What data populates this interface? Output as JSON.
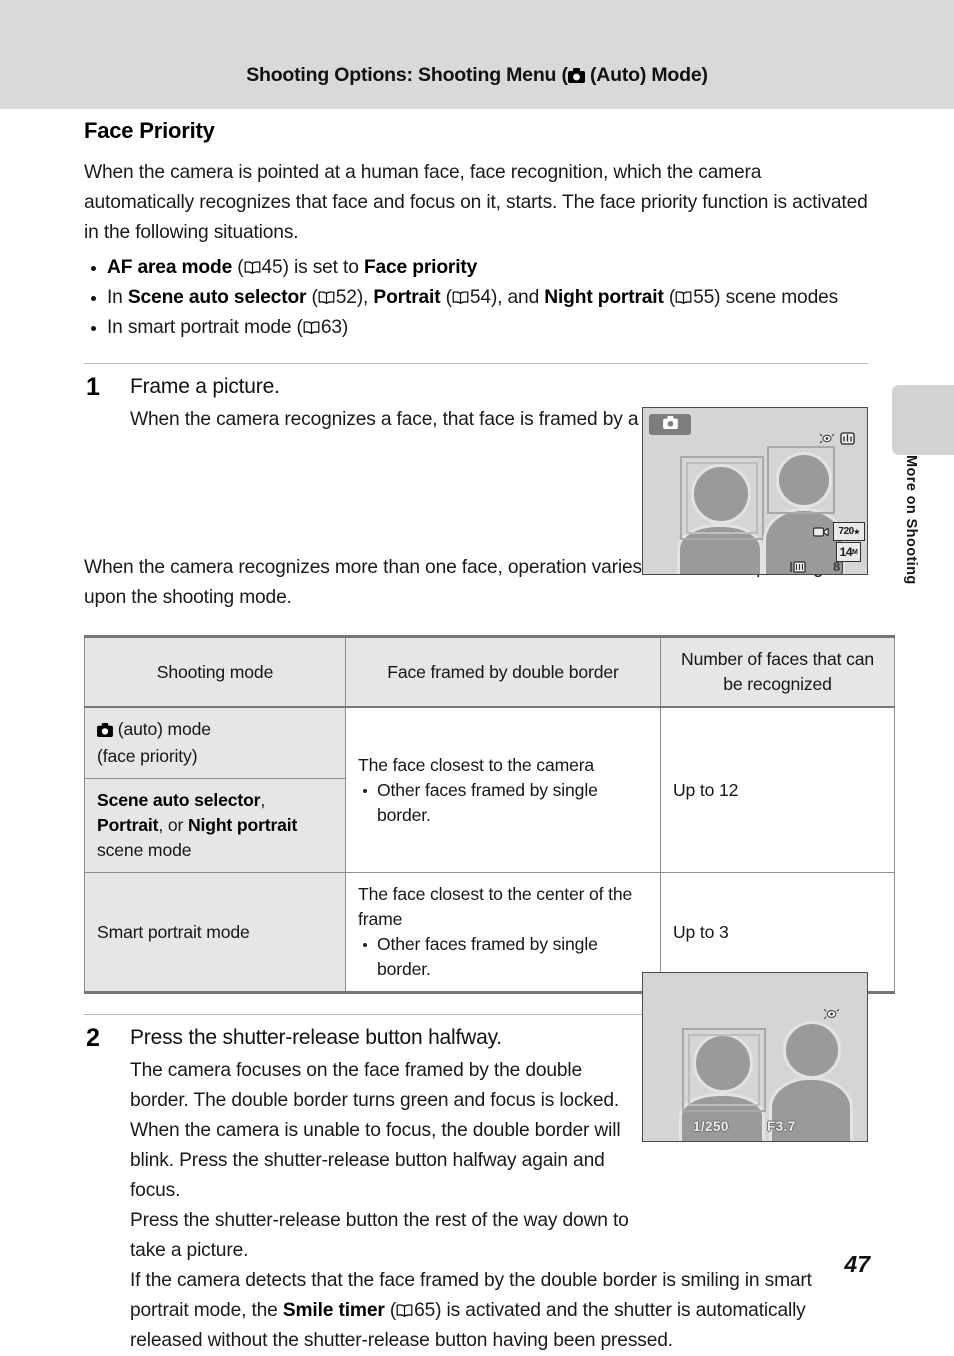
{
  "header": {
    "title_before": "Shooting Options: Shooting Menu (",
    "camera_icon": "camera-icon",
    "title_after": " (Auto) Mode)"
  },
  "thumb_tab": {
    "label": "More on Shooting"
  },
  "section": {
    "title": "Face Priority",
    "intro": "When the camera is pointed at a human face, face recognition, which the camera automatically recognizes that face and focus on it, starts. The face priority function is activated in the following situations."
  },
  "bullets": [
    {
      "pre": "",
      "bold1": "AF area mode",
      "mid1": " (",
      "ref1": "45",
      "mid2": ") is set to ",
      "bold2": "Face priority",
      "post": ""
    },
    {
      "pre": "In ",
      "bold1": "Scene auto selector",
      "mid1": " (",
      "ref1": "52",
      "mid2": "), ",
      "bold2": "Portrait",
      "mid3": " (",
      "ref2": "54",
      "mid4": "), and ",
      "bold3": "Night portrait",
      "mid5": " (",
      "ref3": "55",
      "post": ") scene modes"
    },
    {
      "pre": "In smart portrait mode (",
      "ref1": "63",
      "post": ")"
    }
  ],
  "steps": [
    {
      "number": "1",
      "heading": "Frame a picture.",
      "body": "When the camera recognizes a face, that face is framed by a yellow double border."
    },
    {
      "number": "2",
      "heading": "Press the shutter-release button halfway.",
      "para1": "The camera focuses on the face framed by the double border. The double border turns green and focus is locked. When the camera is unable to focus, the double border will blink. Press the shutter-release button halfway again and focus.",
      "para2": "Press the shutter-release button the rest of the way down to take a picture.",
      "para3_pre": "If the camera detects that the face framed by the double border is smiling in smart portrait mode, the ",
      "para3_bold": "Smile timer",
      "para3_mid": " (",
      "para3_ref": "65",
      "para3_post": ") is activated and the shutter is automatically released without the shutter-release button having been pressed."
    }
  ],
  "mid_paragraph": "When the camera recognizes more than one face, operation varies as follows depending upon the shooting mode.",
  "lcd1": {
    "mode_badge_icon": "camera-icon",
    "indicators": {
      "blink_icon": "blink-warning-icon",
      "vr_icon": "vibration-reduction-icon",
      "movie_icon": "movie-option-icon",
      "movie_option": "720",
      "image_size": "14",
      "image_size_unit": "M",
      "memory_icon": "internal-memory-icon",
      "shots_remaining": "8"
    }
  },
  "lcd2": {
    "indicators": {
      "blink_icon": "blink-warning-icon"
    },
    "shutter_speed": "1/250",
    "aperture": "F3.7"
  },
  "table": {
    "headers": [
      "Shooting mode",
      "Face framed by double border",
      "Number of faces that can be recognized"
    ],
    "rows": [
      {
        "mode_icon": "camera-icon",
        "mode_line1": " (auto) mode",
        "mode_line2": "(face priority)",
        "frame_main": "The face closest to the camera",
        "frame_note": "Other faces framed by single border.",
        "count": "Up to 12"
      },
      {
        "mode_bold1": "Scene auto selector",
        "mode_mid1": ", ",
        "mode_bold2": "Portrait",
        "mode_mid2": ", or ",
        "mode_bold3": "Night portrait",
        "mode_post": " scene mode"
      },
      {
        "mode": "Smart portrait mode",
        "frame_main": "The face closest to the center of the frame",
        "frame_note": "Other faces framed by single border.",
        "count": "Up to 3"
      }
    ]
  },
  "folio": {
    "page_number": "47"
  }
}
